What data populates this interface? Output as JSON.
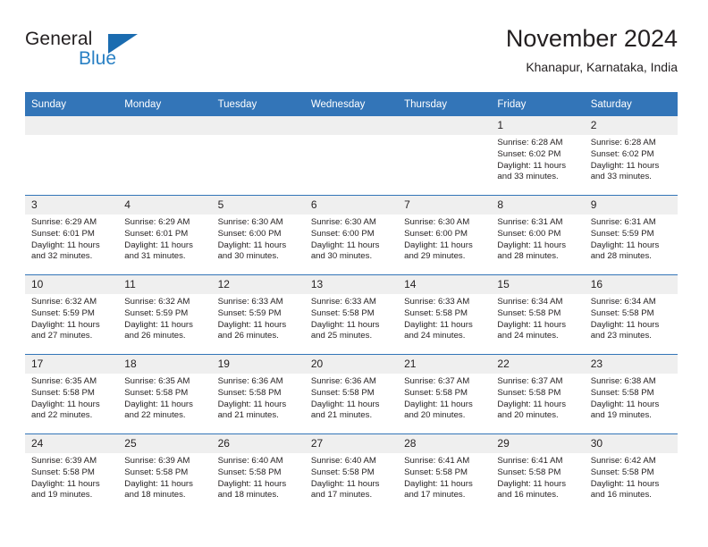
{
  "brand": {
    "name_part1": "General",
    "name_part2": "Blue",
    "triangle_color": "#1b6cb0",
    "blue_text_color": "#2980c4"
  },
  "header": {
    "title": "November 2024",
    "subtitle": "Khanapur, Karnataka, India"
  },
  "theme": {
    "header_bg": "#3375b8",
    "header_text": "#ffffff",
    "daynum_bg": "#efefef",
    "row_divider": "#3375b8",
    "body_text": "#231f20"
  },
  "weekday_headers": [
    "Sunday",
    "Monday",
    "Tuesday",
    "Wednesday",
    "Thursday",
    "Friday",
    "Saturday"
  ],
  "weeks": [
    [
      {
        "day": "",
        "empty": true,
        "lines": []
      },
      {
        "day": "",
        "empty": true,
        "lines": []
      },
      {
        "day": "",
        "empty": true,
        "lines": []
      },
      {
        "day": "",
        "empty": true,
        "lines": []
      },
      {
        "day": "",
        "empty": true,
        "lines": []
      },
      {
        "day": "1",
        "empty": false,
        "lines": [
          "Sunrise: 6:28 AM",
          "Sunset: 6:02 PM",
          "Daylight: 11 hours",
          "and 33 minutes."
        ]
      },
      {
        "day": "2",
        "empty": false,
        "lines": [
          "Sunrise: 6:28 AM",
          "Sunset: 6:02 PM",
          "Daylight: 11 hours",
          "and 33 minutes."
        ]
      }
    ],
    [
      {
        "day": "3",
        "empty": false,
        "lines": [
          "Sunrise: 6:29 AM",
          "Sunset: 6:01 PM",
          "Daylight: 11 hours",
          "and 32 minutes."
        ]
      },
      {
        "day": "4",
        "empty": false,
        "lines": [
          "Sunrise: 6:29 AM",
          "Sunset: 6:01 PM",
          "Daylight: 11 hours",
          "and 31 minutes."
        ]
      },
      {
        "day": "5",
        "empty": false,
        "lines": [
          "Sunrise: 6:30 AM",
          "Sunset: 6:00 PM",
          "Daylight: 11 hours",
          "and 30 minutes."
        ]
      },
      {
        "day": "6",
        "empty": false,
        "lines": [
          "Sunrise: 6:30 AM",
          "Sunset: 6:00 PM",
          "Daylight: 11 hours",
          "and 30 minutes."
        ]
      },
      {
        "day": "7",
        "empty": false,
        "lines": [
          "Sunrise: 6:30 AM",
          "Sunset: 6:00 PM",
          "Daylight: 11 hours",
          "and 29 minutes."
        ]
      },
      {
        "day": "8",
        "empty": false,
        "lines": [
          "Sunrise: 6:31 AM",
          "Sunset: 6:00 PM",
          "Daylight: 11 hours",
          "and 28 minutes."
        ]
      },
      {
        "day": "9",
        "empty": false,
        "lines": [
          "Sunrise: 6:31 AM",
          "Sunset: 5:59 PM",
          "Daylight: 11 hours",
          "and 28 minutes."
        ]
      }
    ],
    [
      {
        "day": "10",
        "empty": false,
        "lines": [
          "Sunrise: 6:32 AM",
          "Sunset: 5:59 PM",
          "Daylight: 11 hours",
          "and 27 minutes."
        ]
      },
      {
        "day": "11",
        "empty": false,
        "lines": [
          "Sunrise: 6:32 AM",
          "Sunset: 5:59 PM",
          "Daylight: 11 hours",
          "and 26 minutes."
        ]
      },
      {
        "day": "12",
        "empty": false,
        "lines": [
          "Sunrise: 6:33 AM",
          "Sunset: 5:59 PM",
          "Daylight: 11 hours",
          "and 26 minutes."
        ]
      },
      {
        "day": "13",
        "empty": false,
        "lines": [
          "Sunrise: 6:33 AM",
          "Sunset: 5:58 PM",
          "Daylight: 11 hours",
          "and 25 minutes."
        ]
      },
      {
        "day": "14",
        "empty": false,
        "lines": [
          "Sunrise: 6:33 AM",
          "Sunset: 5:58 PM",
          "Daylight: 11 hours",
          "and 24 minutes."
        ]
      },
      {
        "day": "15",
        "empty": false,
        "lines": [
          "Sunrise: 6:34 AM",
          "Sunset: 5:58 PM",
          "Daylight: 11 hours",
          "and 24 minutes."
        ]
      },
      {
        "day": "16",
        "empty": false,
        "lines": [
          "Sunrise: 6:34 AM",
          "Sunset: 5:58 PM",
          "Daylight: 11 hours",
          "and 23 minutes."
        ]
      }
    ],
    [
      {
        "day": "17",
        "empty": false,
        "lines": [
          "Sunrise: 6:35 AM",
          "Sunset: 5:58 PM",
          "Daylight: 11 hours",
          "and 22 minutes."
        ]
      },
      {
        "day": "18",
        "empty": false,
        "lines": [
          "Sunrise: 6:35 AM",
          "Sunset: 5:58 PM",
          "Daylight: 11 hours",
          "and 22 minutes."
        ]
      },
      {
        "day": "19",
        "empty": false,
        "lines": [
          "Sunrise: 6:36 AM",
          "Sunset: 5:58 PM",
          "Daylight: 11 hours",
          "and 21 minutes."
        ]
      },
      {
        "day": "20",
        "empty": false,
        "lines": [
          "Sunrise: 6:36 AM",
          "Sunset: 5:58 PM",
          "Daylight: 11 hours",
          "and 21 minutes."
        ]
      },
      {
        "day": "21",
        "empty": false,
        "lines": [
          "Sunrise: 6:37 AM",
          "Sunset: 5:58 PM",
          "Daylight: 11 hours",
          "and 20 minutes."
        ]
      },
      {
        "day": "22",
        "empty": false,
        "lines": [
          "Sunrise: 6:37 AM",
          "Sunset: 5:58 PM",
          "Daylight: 11 hours",
          "and 20 minutes."
        ]
      },
      {
        "day": "23",
        "empty": false,
        "lines": [
          "Sunrise: 6:38 AM",
          "Sunset: 5:58 PM",
          "Daylight: 11 hours",
          "and 19 minutes."
        ]
      }
    ],
    [
      {
        "day": "24",
        "empty": false,
        "lines": [
          "Sunrise: 6:39 AM",
          "Sunset: 5:58 PM",
          "Daylight: 11 hours",
          "and 19 minutes."
        ]
      },
      {
        "day": "25",
        "empty": false,
        "lines": [
          "Sunrise: 6:39 AM",
          "Sunset: 5:58 PM",
          "Daylight: 11 hours",
          "and 18 minutes."
        ]
      },
      {
        "day": "26",
        "empty": false,
        "lines": [
          "Sunrise: 6:40 AM",
          "Sunset: 5:58 PM",
          "Daylight: 11 hours",
          "and 18 minutes."
        ]
      },
      {
        "day": "27",
        "empty": false,
        "lines": [
          "Sunrise: 6:40 AM",
          "Sunset: 5:58 PM",
          "Daylight: 11 hours",
          "and 17 minutes."
        ]
      },
      {
        "day": "28",
        "empty": false,
        "lines": [
          "Sunrise: 6:41 AM",
          "Sunset: 5:58 PM",
          "Daylight: 11 hours",
          "and 17 minutes."
        ]
      },
      {
        "day": "29",
        "empty": false,
        "lines": [
          "Sunrise: 6:41 AM",
          "Sunset: 5:58 PM",
          "Daylight: 11 hours",
          "and 16 minutes."
        ]
      },
      {
        "day": "30",
        "empty": false,
        "lines": [
          "Sunrise: 6:42 AM",
          "Sunset: 5:58 PM",
          "Daylight: 11 hours",
          "and 16 minutes."
        ]
      }
    ]
  ]
}
